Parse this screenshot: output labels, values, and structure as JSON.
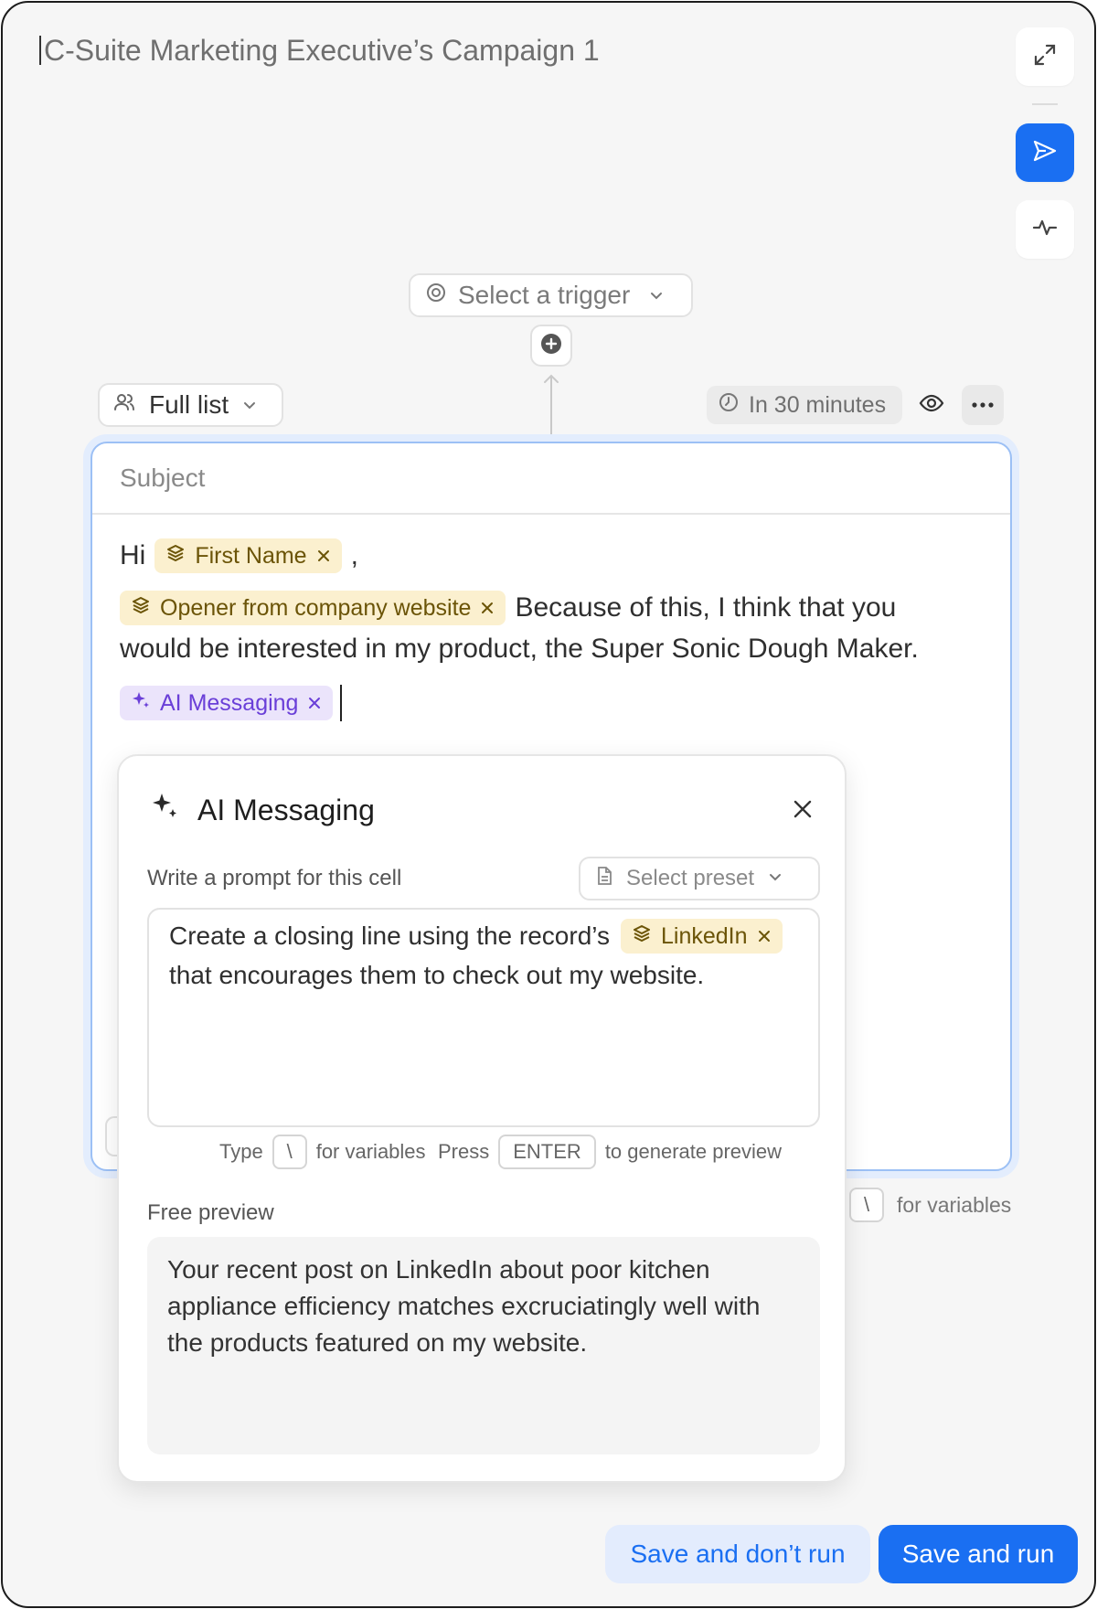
{
  "header": {
    "campaign_title": "C-Suite Marketing Executive’s Campaign 1"
  },
  "side_toolbar": {
    "icons": [
      "expand-icon",
      "send-icon",
      "activity-icon"
    ]
  },
  "workflow": {
    "trigger_placeholder": "Select a trigger",
    "audience_label": "Full list",
    "schedule_label": "In 30 minutes"
  },
  "editor": {
    "subject_placeholder": "Subject",
    "greeting": "Hi",
    "comma": ",",
    "chips": {
      "first_name": "First Name",
      "opener": "Opener from company website",
      "ai_messaging": "AI Messaging"
    },
    "body_line_1": "Because of this, I think that you",
    "body_line_2": "would be interested in my product, the Super Sonic Dough Maker.",
    "hint_key": "\\",
    "hint_text": "for variables"
  },
  "ai_popup": {
    "title": "AI Messaging",
    "prompt_label": "Write a prompt for this cell",
    "preset_placeholder": "Select preset",
    "prompt_line_1": "Create a closing line using the record’s",
    "prompt_chip": "LinkedIn",
    "prompt_line_2": "that encourages them to check out my website.",
    "hint_type": "Type",
    "hint_key_backslash": "\\",
    "hint_for_variables": "for variables",
    "hint_press": "Press",
    "hint_key_enter": "ENTER",
    "hint_generate": "to generate preview",
    "preview_label": "Free preview",
    "preview_text": "Your recent post on LinkedIn about poor kitchen appliance efficiency matches excruciatingly well with the products featured on my website."
  },
  "footer": {
    "save_no_run": "Save and don’t run",
    "save_run": "Save and run"
  },
  "colors": {
    "accent": "#1a6ff2",
    "variable_chip_bg": "#fbf0cf",
    "ai_chip_bg": "#ebe4fb",
    "ai_chip_text": "#6a3fd8"
  }
}
